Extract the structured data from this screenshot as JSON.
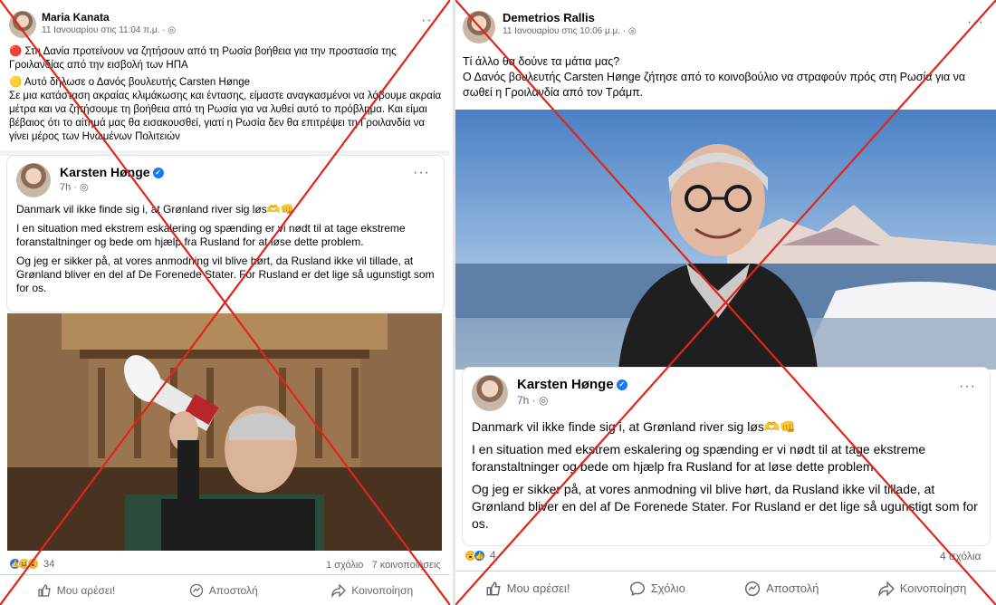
{
  "left_post": {
    "author": "Maria Kanata",
    "time": "11 Ιανουαρίου στις 11:04 π.μ. · ",
    "body": [
      "🔴 Στη Δανία προτείνουν να ζητήσουν από τη Ρωσία βοήθεια για την προστασία της Γροιλανδίας από την εισβολή των ΗΠΑ",
      "🟡 Αυτό δήλωσε ο Δανός βουλευτής Carsten Hønge",
      "Σε μια κατάσταση ακραίας κλιμάκωσης και έντασης, είμαστε αναγκασμένοι να λάβουμε ακραία μέτρα και να ζητήσουμε τη βοήθεια από τη Ρωσία για να λυθεί αυτό το πρόβλημα. Και είμαι βέβαιος ότι το αίτημά μας θα εισακουσθεί, γιατί η Ρωσία δεν θα επιτρέψει τη Γροιλανδία να γίνει μέρος των Ηνωμένων Πολιτειών"
    ],
    "shared": {
      "author": "Karsten Hønge",
      "time": "7h · ",
      "body": [
        "Danmark vil ikke finde sig i, at Grønland river sig løs🫶👊",
        "I en situation med ekstrem eskalering og spænding er vi nødt til at tage ekstreme foranstaltninger og bede om hjælp fra Rusland for at løse dette problem.",
        "Og jeg er sikker på, at vores anmodning vil blive hørt, da Rusland ikke vil tillade, at Grønland bliver en del af De Forenede Stater. For Rusland er det lige så ugunstigt som for os."
      ]
    },
    "reactions_count": "34",
    "counts_text": "1 σχόλιο   7 κοινοποιήσεις",
    "actions": [
      "Μου αρέσει!",
      "Αποστολή",
      "Κοινοποίηση"
    ]
  },
  "right_post": {
    "author": "Demetrios Rallis",
    "time": "11 Ιανουαρίου στις 10:06 μ.μ. · ",
    "body": [
      "Τί άλλο θα δούνε τα μάτια μας?",
      "Ο Δανός βουλευτής Carsten Hønge ζήτησε από το κοινοβούλιο να στραφούν πρός στη Ρωσία για να σωθεί η Γροιλανδία από τον Τράμπ."
    ],
    "shared": {
      "author": "Karsten Hønge",
      "time": "7h · ",
      "body": [
        "Danmark vil ikke finde sig i, at Grønland river sig løs🫶👊",
        "I en situation med ekstrem eskalering og spænding er vi nødt til at tage ekstreme foranstaltninger og bede om hjælp fra Rusland for at løse dette problem.",
        "Og jeg er sikker på, at vores anmodning vil blive hørt, da Rusland ikke vil tillade, at Grønland bliver en del af De Forenede Stater. For Rusland er det lige så ugunstigt som for os."
      ]
    },
    "reactions_count": "4",
    "counts_text": "4 σχόλια",
    "actions": [
      "Μου αρέσει!",
      "Σχόλιο",
      "Αποστολή",
      "Κοινοποίηση"
    ]
  },
  "colors": {
    "cross_red": "#e0251b",
    "facebook_blue": "#1877f2",
    "meta_gray": "#65676b"
  },
  "icons": [
    "globe-icon",
    "verified-badge-icon",
    "more-options-icon",
    "like-icon",
    "comment-icon",
    "messenger-icon",
    "share-icon"
  ]
}
